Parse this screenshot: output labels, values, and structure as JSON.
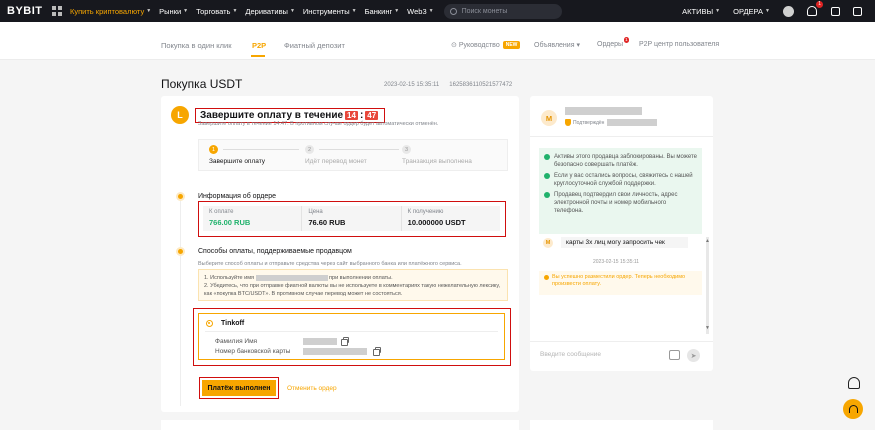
{
  "nav": {
    "logo": "BYBIT",
    "items": [
      {
        "label": "Купить криптовалюту",
        "active": true
      },
      {
        "label": "Рынки",
        "active": false
      },
      {
        "label": "Торговать",
        "active": false
      },
      {
        "label": "Деривативы",
        "active": false
      },
      {
        "label": "Инструменты",
        "active": false
      },
      {
        "label": "Банкинг",
        "active": false
      },
      {
        "label": "Web3",
        "active": false
      }
    ],
    "search_placeholder": "Поиск монеты",
    "assets_label": "АКТИВЫ",
    "orders_label": "ОРДЕРА",
    "notification_count": "1"
  },
  "subnav": {
    "tabs": [
      "Покупка в один клик",
      "P2P",
      "Фиатный депозит"
    ],
    "active_tab": "P2P",
    "guide_label": "Руководство",
    "guide_badge": "NEW",
    "ads_label": "Объявления",
    "orders_label": "Ордеры",
    "orders_count": "1",
    "p2p_center_label": "P2P центр пользователя"
  },
  "page": {
    "title": "Покупка USDT",
    "order_time": "2023-02-15 15:35:11",
    "order_id": "1625836110521577472"
  },
  "timer": {
    "avatar_letter": "L",
    "title": "Завершите оплату в течение",
    "minutes": "14",
    "seconds": "47",
    "subtitle": "Завершите оплату в течение 14:47. В противном случае ордер будет автоматически отменён."
  },
  "steps": [
    {
      "num": "1",
      "label": "Завершите оплату",
      "active": true
    },
    {
      "num": "2",
      "label": "Идёт перевод монет",
      "active": false
    },
    {
      "num": "3",
      "label": "Транзакция выполнена",
      "active": false
    }
  ],
  "order_info": {
    "title": "Информация об ордере",
    "pay_label": "К оплате",
    "pay_value": "766.00 RUB",
    "price_label": "Цена",
    "price_value": "76.60 RUB",
    "receive_label": "К получению",
    "receive_value": "10.000000 USDT"
  },
  "payment": {
    "title": "Способы оплаты, поддерживаемые продавцом",
    "subtitle": "Выберите способ оплаты и отправьте средства через сайт выбранного банка или платёжного сервиса.",
    "notice_1a": "1. Используйте имя",
    "notice_1b": "при выполнении оплаты.",
    "notice_2": "2. Убедитесь, что при отправке фиатной валюты вы не используете в комментариях такую нежелательную лексику, как «покупка BTC/USDT». В противном случае перевод может не состояться.",
    "method_name": "Tinkoff",
    "name_label": "Фамилия Имя",
    "card_label": "Номер банковской карты"
  },
  "actions": {
    "paid_button": "Платёж выполнен",
    "cancel_link": "Отменить ордер"
  },
  "chat": {
    "merchant_letter": "M",
    "verified_label": "Подтверждён",
    "info": [
      "Активы этого продавца заблокированы. Вы можете безопасно совершать платёж.",
      "Если у вас остались вопросы, свяжитесь с нашей круглосуточной службой поддержки.",
      "Продавец подтвердил свои личность, адрес электронной почты и номер мобильного телефона."
    ],
    "message_text": "карты 3х лиц могу запросить чек",
    "message_time": "2023-02-15 15:35:11",
    "system_message": "Вы успешно разместили ордер. Теперь необходимо произвести оплату.",
    "input_placeholder": "Введите сообщение"
  },
  "colors": {
    "accent": "#f7a600",
    "highlight_border": "#d00e0e",
    "green": "#20b26c"
  }
}
